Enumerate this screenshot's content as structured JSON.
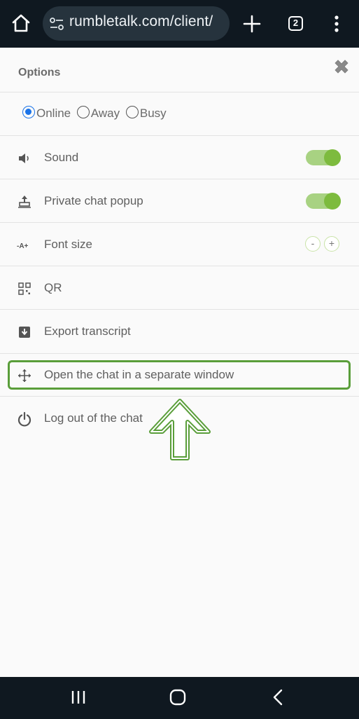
{
  "browser": {
    "url": "rumbletalk.com/client/",
    "tab_count": "2"
  },
  "options": {
    "title": "Options",
    "status": {
      "online": "Online",
      "away": "Away",
      "busy": "Busy",
      "selected": "Online"
    },
    "items": [
      {
        "label": "Sound",
        "icon": "speaker-icon",
        "control": "toggle",
        "on": true
      },
      {
        "label": "Private chat popup",
        "icon": "popup-icon",
        "control": "toggle",
        "on": true
      },
      {
        "label": "Font size",
        "icon": "font-size-icon",
        "control": "stepper",
        "minus": "-",
        "plus": "+"
      },
      {
        "label": "QR",
        "icon": "qr-icon"
      },
      {
        "label": "Export transcript",
        "icon": "download-icon"
      },
      {
        "label": "Open the chat in a separate window",
        "icon": "move-icon",
        "highlighted": true
      },
      {
        "label": "Log out of the chat",
        "icon": "power-icon"
      }
    ]
  },
  "colors": {
    "toggle_on": "#7dbb3e",
    "highlight": "#5a9e3a",
    "radio_selected": "#1a73e8",
    "system_bar": "#0f1820"
  }
}
